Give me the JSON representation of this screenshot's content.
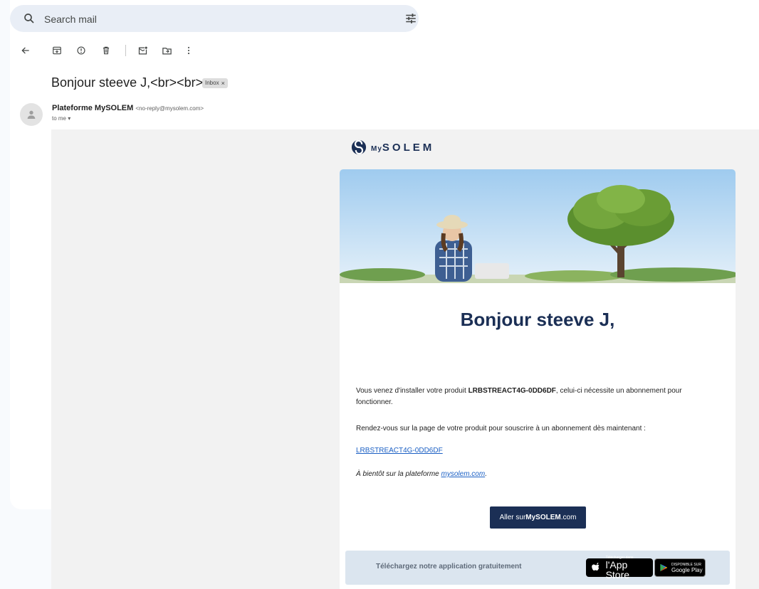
{
  "search": {
    "placeholder": "Search mail"
  },
  "email": {
    "subject": "Bonjour steeve J,<br><br>",
    "label": "Inbox",
    "sender_name": "Plateforme MySOLEM",
    "sender_address": "<no-reply@mysolem.com>",
    "recipient": "to me"
  },
  "body": {
    "logo": {
      "my": "My",
      "brand": "SOLEM"
    },
    "heading": "Bonjour steeve J,",
    "p1_before": "Vous venez d'installer votre produit ",
    "product_code": "LRBSTREACT4G-0DD6DF",
    "p1_after": ", celui-ci nécessite un abonnement pour fonctionner.",
    "p2": "Rendez-vous sur la page de votre produit pour souscrire à un abonnement dès maintenant :",
    "product_link": "LRBSTREACT4G-0DD6DF",
    "p4_before": "À bientôt sur la plateforme ",
    "site_link": "mysolem.com",
    "p4_after": ".",
    "cta_before": "Aller sur ",
    "cta_brand": "MySOLEM",
    "cta_after": ".com",
    "footer_text": "Téléchargez notre application gratuitement",
    "appstore_small": "Télécharger dans",
    "appstore_big": "l'App Store",
    "gplay_small": "DISPONIBLE SUR",
    "gplay_big": "Google Play"
  },
  "colors": {
    "brand": "#1b2f55",
    "link": "#1a5fc4",
    "footer_bg": "#dbe5ef"
  }
}
